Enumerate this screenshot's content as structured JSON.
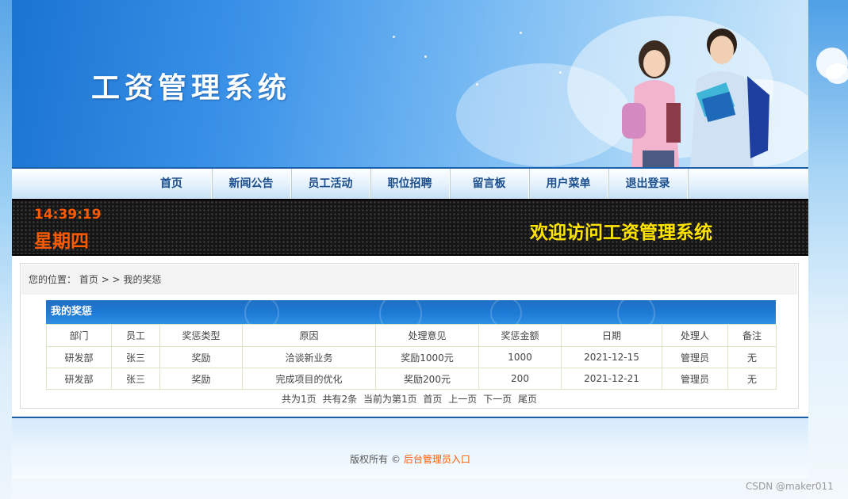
{
  "banner": {
    "title": "工资管理系统"
  },
  "nav": {
    "items": [
      "首页",
      "新闻公告",
      "员工活动",
      "职位招聘",
      "留言板",
      "用户菜单",
      "退出登录"
    ]
  },
  "led": {
    "time": "14:39:19",
    "weekday": "星期四",
    "welcome": "欢迎访问工资管理系统"
  },
  "breadcrumb": {
    "prefix": "您的位置：",
    "home": "首页",
    "sep": "> >",
    "current": "我的奖惩"
  },
  "panel": {
    "title": "我的奖惩"
  },
  "table": {
    "headers": [
      "部门",
      "员工",
      "奖惩类型",
      "原因",
      "处理意见",
      "奖惩金额",
      "日期",
      "处理人",
      "备注"
    ],
    "rows": [
      [
        "研发部",
        "张三",
        "奖励",
        "洽谈新业务",
        "奖励1000元",
        "1000",
        "2021-12-15",
        "管理员",
        "无"
      ],
      [
        "研发部",
        "张三",
        "奖励",
        "完成项目的优化",
        "奖励200元",
        "200",
        "2021-12-21",
        "管理员",
        "无"
      ]
    ]
  },
  "pager": {
    "total_pages": "共为1页",
    "total_records": "共有2条",
    "current": "当前为第1页",
    "first": "首页",
    "prev": "上一页",
    "next": "下一页",
    "last": "尾页"
  },
  "footer": {
    "copyright": "版权所有 ©",
    "admin_link": "后台管理员入口"
  },
  "watermark": "CSDN @maker011",
  "colors": {
    "nav_text": "#1b4e8c",
    "led_time": "#ff5a00",
    "led_welcome": "#ffe400",
    "link": "#ff5a00",
    "header_blue": "#1e7bd6"
  }
}
